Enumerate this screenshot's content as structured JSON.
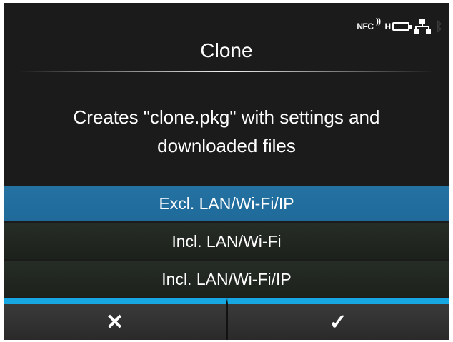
{
  "status_bar": {
    "nfc_label": "NFC",
    "nfc_waves": "))",
    "battery_prefix": "H",
    "icons": [
      "nfc-icon",
      "battery-icon",
      "lan-icon",
      "bluetooth-icon"
    ]
  },
  "header": {
    "title": "Clone"
  },
  "description": {
    "line1": "Creates \"clone.pkg\" with settings and",
    "line2": "downloaded files"
  },
  "options": [
    {
      "label": "Excl. LAN/Wi-Fi/IP",
      "selected": true
    },
    {
      "label": "Incl. LAN/Wi-Fi",
      "selected": false
    },
    {
      "label": "Incl. LAN/Wi-Fi/IP",
      "selected": false
    }
  ],
  "actions": {
    "cancel_glyph": "✕",
    "confirm_glyph": "✓",
    "icons": [
      "cancel-icon",
      "confirm-icon"
    ]
  },
  "colors": {
    "background": "#1b1b1b",
    "selected": "#2472a3",
    "accent": "#17a8e3"
  }
}
